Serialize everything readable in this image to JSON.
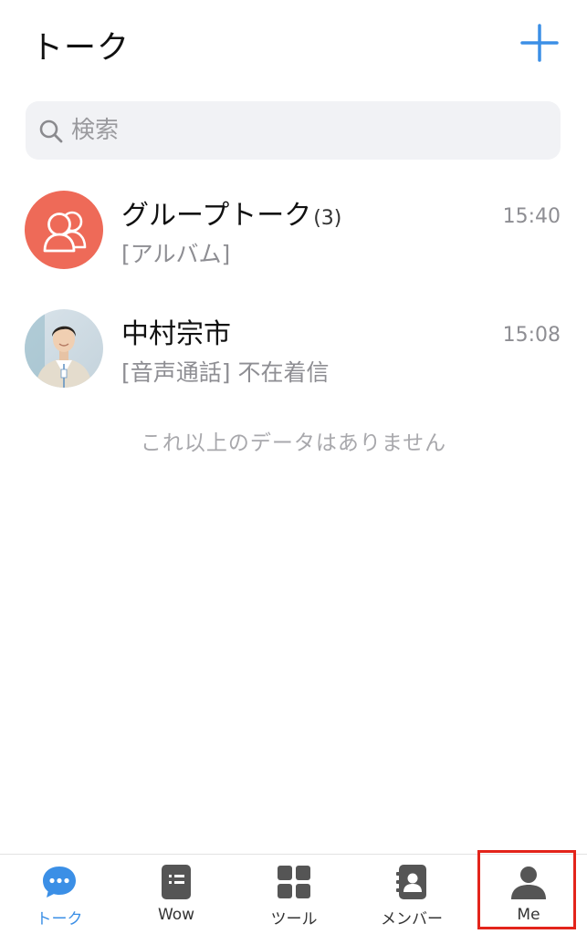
{
  "header": {
    "title": "トーク"
  },
  "search": {
    "placeholder": "検索"
  },
  "chats": [
    {
      "name": "グループトーク",
      "count": "(3)",
      "preview": "[アルバム]",
      "time": "15:40"
    },
    {
      "name": "中村宗市",
      "preview": "[音声通話] 不在着信",
      "time": "15:08"
    }
  ],
  "end_note": "これ以上のデータはありません",
  "tabs": [
    {
      "label": "トーク",
      "icon": "chat-bubble-icon",
      "active": true
    },
    {
      "label": "Wow",
      "icon": "note-list-icon",
      "active": false
    },
    {
      "label": "ツール",
      "icon": "grid-icon",
      "active": false
    },
    {
      "label": "メンバー",
      "icon": "contacts-book-icon",
      "active": false
    },
    {
      "label": "Me",
      "icon": "person-icon",
      "active": false,
      "highlighted": true
    }
  ],
  "colors": {
    "accent": "#3b8fe6",
    "group_avatar": "#ee6a58",
    "highlight_box": "#e3241b"
  }
}
